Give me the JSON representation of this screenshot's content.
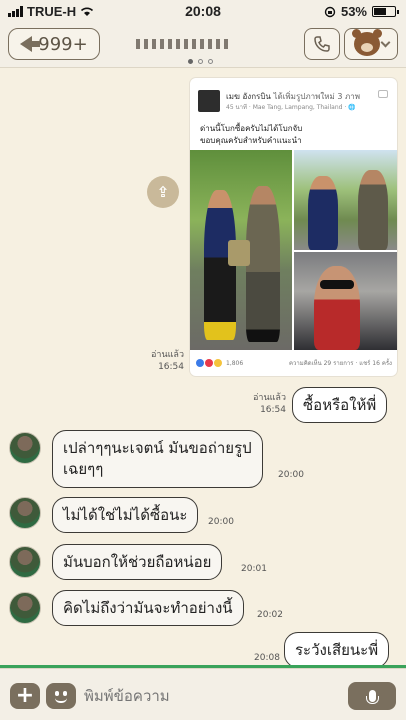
{
  "status_bar": {
    "carrier": "TRUE-H",
    "time": "20:08",
    "battery": "53%"
  },
  "header": {
    "back_count": "999+"
  },
  "photo_post": {
    "author": "เมฆ อังกรบิน",
    "action": "ได้เพิ่มรูปภาพใหม่ 3 ภาพ",
    "meta": "45 นาที · Mae Tang, Lampang, Thailand · 🌐",
    "caption_line1": "ด่านนี้โบกซื้อครับไม่ได้โบกจับ",
    "caption_line2": "ขอบคุณครับสำหรับคำแนะนำ",
    "reactions_count": "1,806",
    "comments_shares": "ความคิดเห็น 29 รายการ · แชร์ 16 ครั้ง"
  },
  "messages": [
    {
      "side": "out",
      "read_label": "อ่านแล้ว",
      "time": "16:54",
      "type": "photo"
    },
    {
      "side": "out",
      "read_label": "อ่านแล้ว",
      "time": "16:54",
      "text": "ซื้อหรือให้พี่"
    },
    {
      "side": "in",
      "time": "20:00",
      "lines": [
        "เปล่าๆๆนะเจตน์ มันขอถ่ายรูป",
        "เฉยๆๆ"
      ]
    },
    {
      "side": "in",
      "time": "20:00",
      "text": "ไม่ได้ใช่ไม่ได้ซื้อนะ"
    },
    {
      "side": "in",
      "time": "20:01",
      "text": "มันบอกให้ช่วยถือหน่อย"
    },
    {
      "side": "in",
      "time": "20:02",
      "text": "คิดไม่ถึงว่ามันจะทำอย่างนี้"
    },
    {
      "side": "out",
      "time": "20:08",
      "text": "ระวังเสียนะพี่"
    }
  ],
  "input": {
    "placeholder": "พิมพ์ข้อความ"
  },
  "icons": {
    "back": "arrow-left-icon",
    "call": "phone-icon",
    "profile": "brown-bear-icon",
    "share": "share-icon",
    "plus": "plus-icon",
    "emoji": "emoji-icon",
    "mic": "microphone-icon"
  },
  "colors": {
    "background": "#f6f0e1",
    "bubble_border": "#3c3a36",
    "button": "#7a6f5e",
    "accent_line": "#3aa35a"
  }
}
